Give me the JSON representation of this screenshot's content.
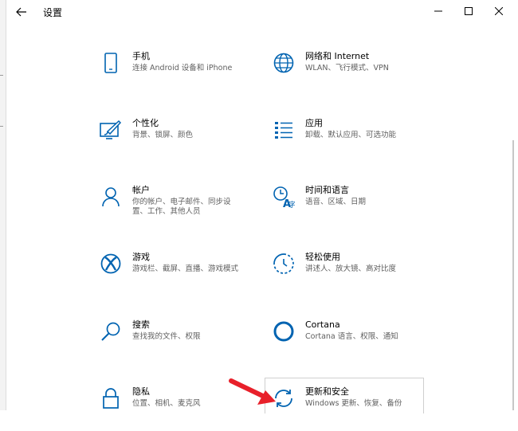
{
  "window": {
    "title": "设置"
  },
  "titlebar": {
    "back_icon": "arrow-left-icon",
    "minimize_icon": "minimize-icon",
    "maximize_icon": "maximize-icon",
    "close_icon": "close-icon"
  },
  "tiles": [
    {
      "title": "手机",
      "desc": "连接 Android 设备和 iPhone",
      "icon": "phone-icon"
    },
    {
      "title": "网络和 Internet",
      "desc": "WLAN、飞行模式、VPN",
      "icon": "globe-icon"
    },
    {
      "title": "个性化",
      "desc": "背景、锁屏、颜色",
      "icon": "paint-screen-icon"
    },
    {
      "title": "应用",
      "desc": "卸载、默认应用、可选功能",
      "icon": "app-list-icon"
    },
    {
      "title": "帐户",
      "desc": "你的帐户、电子邮件、同步设\n置、工作、其他人员",
      "icon": "person-icon"
    },
    {
      "title": "时间和语言",
      "desc": "语音、区域、日期",
      "icon": "time-language-icon"
    },
    {
      "title": "游戏",
      "desc": "游戏栏、截屏、直播、游戏模式",
      "icon": "xbox-icon"
    },
    {
      "title": "轻松使用",
      "desc": "讲述人、放大镜、高对比度",
      "icon": "ease-of-access-icon"
    },
    {
      "title": "搜索",
      "desc": "查找我的文件、权限",
      "icon": "search-icon"
    },
    {
      "title": "Cortana",
      "desc": "Cortana 语言、权限、通知",
      "icon": "cortana-icon"
    },
    {
      "title": "隐私",
      "desc": "位置、相机、麦克风",
      "icon": "lock-icon"
    },
    {
      "title": "更新和安全",
      "desc": "Windows 更新、恢复、备份",
      "icon": "sync-icon"
    }
  ],
  "colors": {
    "accent": "#0063b1",
    "annotation_arrow": "#e8202a"
  }
}
